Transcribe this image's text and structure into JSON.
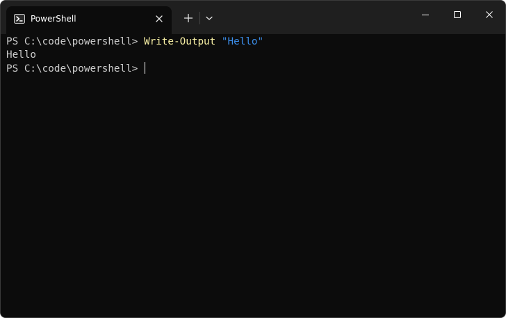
{
  "window": {
    "tab": {
      "title": "PowerShell",
      "icon": "powershell-icon",
      "close_icon": "close-icon"
    },
    "new_tab_icon": "plus-icon",
    "dropdown_icon": "chevron-down-icon",
    "caption_buttons": [
      "minimize-icon",
      "maximize-icon",
      "close-icon"
    ]
  },
  "console": {
    "lines": [
      {
        "prompt": "PS C:\\code\\powershell> ",
        "command": "Write-Output",
        "space": " ",
        "argument": "\"Hello\""
      },
      {
        "output": "Hello"
      },
      {
        "prompt": "PS C:\\code\\powershell> "
      }
    ]
  },
  "colors": {
    "background": "#0c0c0c",
    "titlebar": "#1f1f1f",
    "text": "#cccccc",
    "command": "#f9f1a5",
    "string": "#3b8eea"
  }
}
